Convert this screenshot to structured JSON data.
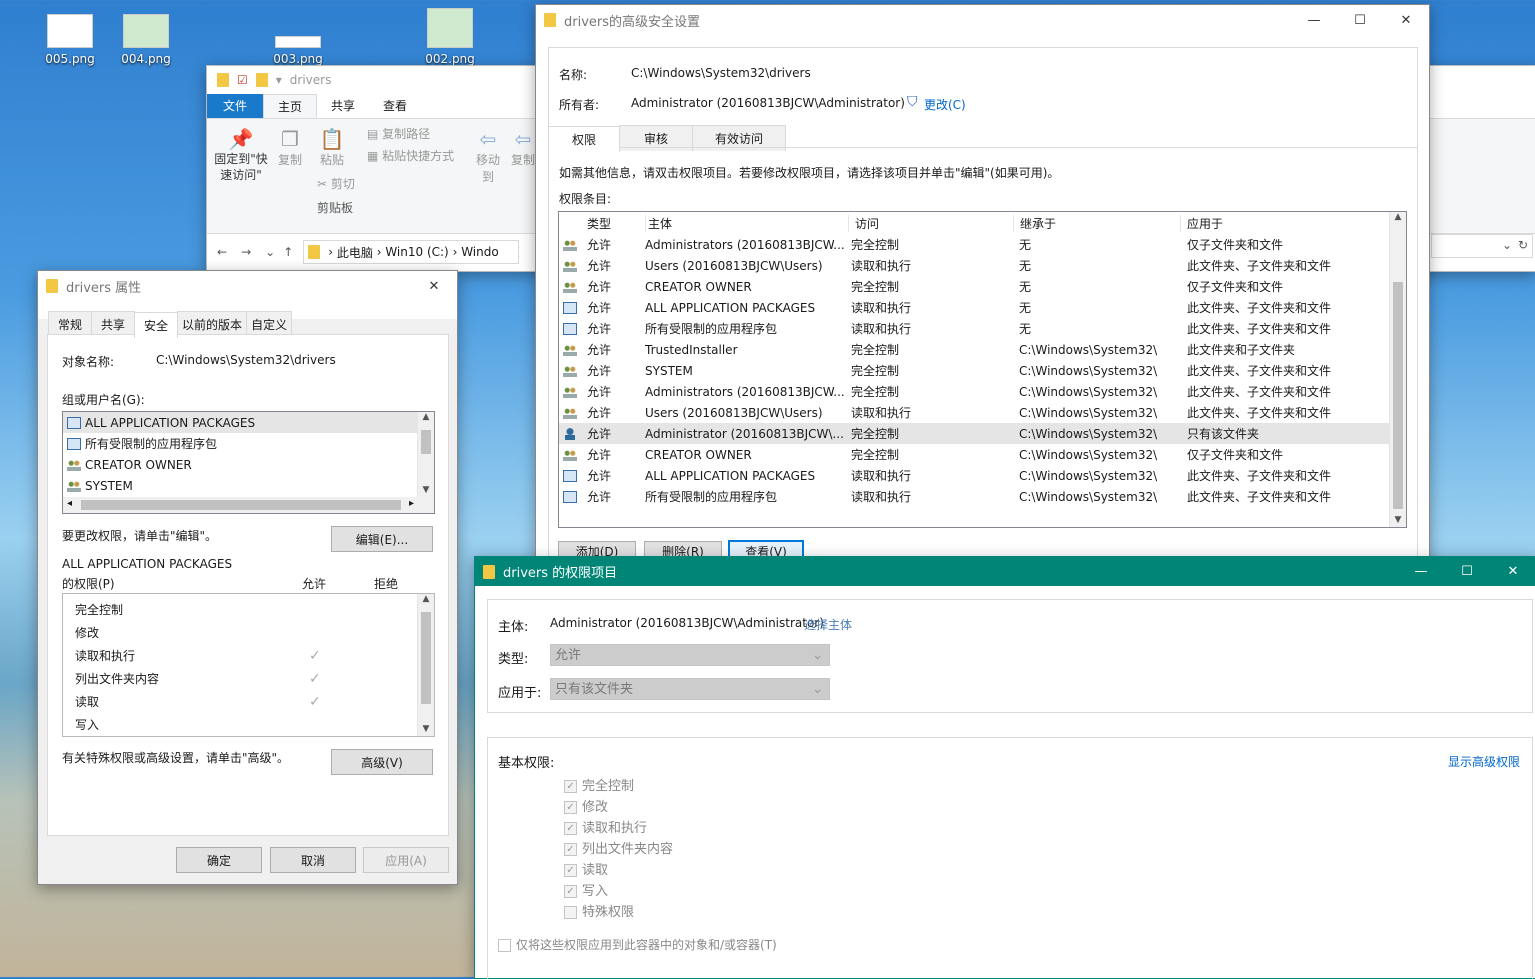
{
  "desktop": {
    "icons": [
      "005.png",
      "004.png",
      "003.png",
      "002.png"
    ]
  },
  "explorer": {
    "title": "drivers",
    "ribbon_tabs": [
      "文件",
      "主页",
      "共享",
      "查看"
    ],
    "pin_label": "固定到\"快速访问\"",
    "copy": "复制",
    "paste": "粘贴",
    "copy_path": "复制路径",
    "paste_shortcut": "粘贴快捷方式",
    "cut": "剪切",
    "clipboard": "剪贴板",
    "move_to": "移动到",
    "copy_to": "复制",
    "breadcrumb": [
      "此电脑",
      "Win10 (C:)",
      "Windo"
    ]
  },
  "props": {
    "title": "drivers 属性",
    "tabs": [
      "常规",
      "共享",
      "安全",
      "以前的版本",
      "自定义"
    ],
    "object_label": "对象名称:",
    "object_value": "C:\\Windows\\System32\\drivers",
    "group_label": "组或用户名(G):",
    "groups": [
      {
        "icon": "app-package-icon",
        "name": "ALL APPLICATION PACKAGES"
      },
      {
        "icon": "app-package-icon",
        "name": "所有受限制的应用程序包"
      },
      {
        "icon": "user-group-icon",
        "name": "CREATOR OWNER"
      },
      {
        "icon": "user-group-icon",
        "name": "SYSTEM"
      }
    ],
    "change_hint": "要更改权限，请单击\"编辑\"。",
    "edit_button": "编辑(E)...",
    "perm_for": "ALL APPLICATION PACKAGES",
    "perm_label": "的权限(P)",
    "allow_col": "允许",
    "deny_col": "拒绝",
    "perms": [
      {
        "name": "完全控制",
        "allow": ""
      },
      {
        "name": "修改",
        "allow": ""
      },
      {
        "name": "读取和执行",
        "allow": "✓"
      },
      {
        "name": "列出文件夹内容",
        "allow": "✓"
      },
      {
        "name": "读取",
        "allow": "✓"
      },
      {
        "name": "写入",
        "allow": ""
      }
    ],
    "advanced_hint": "有关特殊权限或高级设置，请单击\"高级\"。",
    "advanced_button": "高级(V)",
    "ok": "确定",
    "cancel": "取消",
    "apply": "应用(A)"
  },
  "advanced": {
    "title": "drivers的高级安全设置",
    "name_label": "名称:",
    "name_value": "C:\\Windows\\System32\\drivers",
    "owner_label": "所有者:",
    "owner_value": "Administrator (20160813BJCW\\Administrator)",
    "change_link": "更改(C)",
    "tabs": [
      "权限",
      "审核",
      "有效访问"
    ],
    "info": "如需其他信息，请双击权限项目。若要修改权限项目，请选择该项目并单击\"编辑\"(如果可用)。",
    "entries_label": "权限条目:",
    "columns": [
      "类型",
      "主体",
      "访问",
      "继承于",
      "应用于"
    ],
    "rows": [
      {
        "icon": "group",
        "type": "允许",
        "principal": "Administrators (20160813BJCW...",
        "access": "完全控制",
        "inherit": "无",
        "apply": "仅子文件夹和文件"
      },
      {
        "icon": "group",
        "type": "允许",
        "principal": "Users (20160813BJCW\\Users)",
        "access": "读取和执行",
        "inherit": "无",
        "apply": "此文件夹、子文件夹和文件"
      },
      {
        "icon": "group",
        "type": "允许",
        "principal": "CREATOR OWNER",
        "access": "完全控制",
        "inherit": "无",
        "apply": "仅子文件夹和文件"
      },
      {
        "icon": "app",
        "type": "允许",
        "principal": "ALL APPLICATION PACKAGES",
        "access": "读取和执行",
        "inherit": "无",
        "apply": "此文件夹、子文件夹和文件"
      },
      {
        "icon": "app",
        "type": "允许",
        "principal": "所有受限制的应用程序包",
        "access": "读取和执行",
        "inherit": "无",
        "apply": "此文件夹、子文件夹和文件"
      },
      {
        "icon": "group",
        "type": "允许",
        "principal": "TrustedInstaller",
        "access": "完全控制",
        "inherit": "C:\\Windows\\System32\\",
        "apply": "此文件夹和子文件夹"
      },
      {
        "icon": "group",
        "type": "允许",
        "principal": "SYSTEM",
        "access": "完全控制",
        "inherit": "C:\\Windows\\System32\\",
        "apply": "此文件夹、子文件夹和文件"
      },
      {
        "icon": "group",
        "type": "允许",
        "principal": "Administrators (20160813BJCW...",
        "access": "完全控制",
        "inherit": "C:\\Windows\\System32\\",
        "apply": "此文件夹、子文件夹和文件"
      },
      {
        "icon": "group",
        "type": "允许",
        "principal": "Users (20160813BJCW\\Users)",
        "access": "读取和执行",
        "inherit": "C:\\Windows\\System32\\",
        "apply": "此文件夹、子文件夹和文件"
      },
      {
        "icon": "user",
        "type": "允许",
        "principal": "Administrator (20160813BJCW\\...",
        "access": "完全控制",
        "inherit": "C:\\Windows\\System32\\",
        "apply": "只有该文件夹",
        "selected": true
      },
      {
        "icon": "group",
        "type": "允许",
        "principal": "CREATOR OWNER",
        "access": "完全控制",
        "inherit": "C:\\Windows\\System32\\",
        "apply": "仅子文件夹和文件"
      },
      {
        "icon": "app",
        "type": "允许",
        "principal": "ALL APPLICATION PACKAGES",
        "access": "读取和执行",
        "inherit": "C:\\Windows\\System32\\",
        "apply": "此文件夹、子文件夹和文件"
      },
      {
        "icon": "app",
        "type": "允许",
        "principal": "所有受限制的应用程序包",
        "access": "读取和执行",
        "inherit": "C:\\Windows\\System32\\",
        "apply": "此文件夹、子文件夹和文件"
      }
    ],
    "add": "添加(D)",
    "remove": "删除(R)",
    "view": "查看(V)"
  },
  "entry": {
    "title": "drivers 的权限项目",
    "principal_label": "主体:",
    "principal_value": "Administrator (20160813BJCW\\Administrator)",
    "select_principal": "选择主体",
    "type_label": "类型:",
    "type_value": "允许",
    "apply_label": "应用于:",
    "apply_value": "只有该文件夹",
    "basic_label": "基本权限:",
    "show_advanced": "显示高级权限",
    "perms": [
      {
        "name": "完全控制",
        "checked": true
      },
      {
        "name": "修改",
        "checked": true
      },
      {
        "name": "读取和执行",
        "checked": true
      },
      {
        "name": "列出文件夹内容",
        "checked": true
      },
      {
        "name": "读取",
        "checked": true
      },
      {
        "name": "写入",
        "checked": true
      },
      {
        "name": "特殊权限",
        "checked": false
      }
    ],
    "only_apply": "仅将这些权限应用到此容器中的对象和/或容器(T)",
    "accent": "#008577"
  }
}
